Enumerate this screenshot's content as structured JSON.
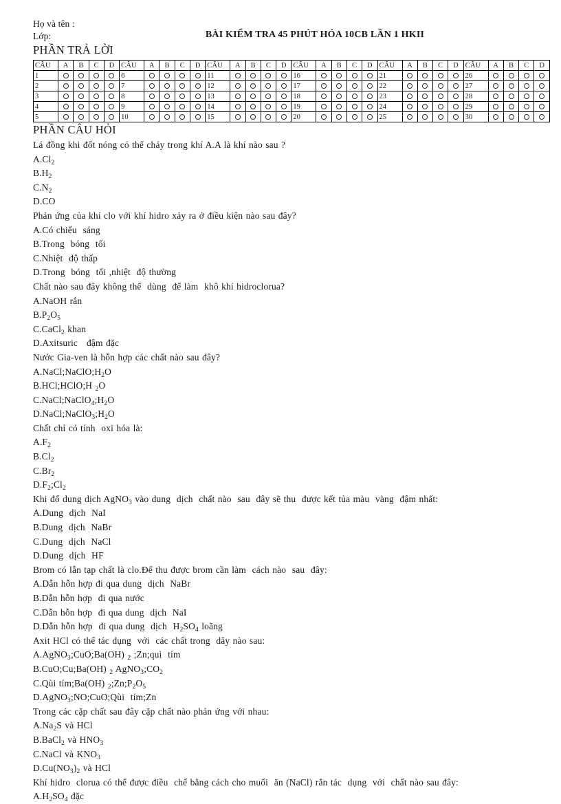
{
  "header": {
    "name_field_label": "Họ và tên :",
    "class_field_label": "Lớp:",
    "title": "BÀI KIỂM TRA 45 PHÚT  HÓA 10CB LẦN 1 HKII",
    "answers_section_heading": "PHẦN TRẢ LỜI",
    "questions_section_heading": "PHẦN CÂU HỎI"
  },
  "answer_table": {
    "column_headers": [
      "CÂU",
      "A",
      "B",
      "C",
      "D"
    ],
    "bubble_glyph": "O",
    "groups": [
      {
        "numbers": [
          "1",
          "2",
          "3",
          "4",
          "5"
        ]
      },
      {
        "numbers": [
          "6",
          "7",
          "8",
          "9",
          "10"
        ]
      },
      {
        "numbers": [
          "11",
          "12",
          "13",
          "14",
          "15"
        ]
      },
      {
        "numbers": [
          "16",
          "17",
          "18",
          "19",
          "20"
        ]
      },
      {
        "numbers": [
          "21",
          "22",
          "23",
          "24",
          "25"
        ]
      },
      {
        "numbers": [
          "26",
          "27",
          "28",
          "29",
          "30"
        ]
      }
    ],
    "rows": 5,
    "groups_count": 6
  },
  "questions": [
    {
      "stem": "Lá đồng khi đốt nóng có thể cháy trong khí A.A là khí nào sau ?",
      "options": [
        "A.Cl<sub>2</sub>",
        "B.H<sub>2</sub>",
        "C.N<sub>2</sub>",
        "D.CO"
      ]
    },
    {
      "stem": "Phản ứng của khí clo với khí hidro xảy ra ở điều kiện nào sau đây?",
      "options": [
        "A.Có chiếu  sáng",
        "B.Trong  bóng  tối",
        "C.Nhiệt  độ thấp",
        "D.Trong  bóng  tối ,nhiệt  độ thường"
      ]
    },
    {
      "stem": "Chất nào sau đây không thể  dùng  để làm  khô khí hidroclorua?",
      "options": [
        "A.NaOH rắn",
        "B.P<sub>2</sub>O<sub>5</sub>",
        "C.CaCl<sub>2</sub> khan",
        "D.Axitsuric   đậm đặc"
      ]
    },
    {
      "stem": "Nước Gia-ven là hỗn hợp các chất nào sau đây?",
      "options": [
        "A.NaCl;NaClO;H<sub>2</sub>O",
        "B.HCl;HClO;H <sub>2</sub>O",
        "C.NaCl;NaClO<sub>4</sub>;H<sub>2</sub>O",
        "D.NaCl;NaClO<sub>3</sub>;H<sub>2</sub>O"
      ]
    },
    {
      "stem": "Chất chỉ có tính  oxi hóa là:",
      "options": [
        "A.F<sub>2</sub>",
        "B.Cl<sub>2</sub>",
        "C.Br<sub>2</sub>",
        "D.F<sub>2</sub>;Cl<sub>2</sub>"
      ]
    },
    {
      "stem": "Khi đổ dung dịch AgNO<sub>3</sub> vào dung  dịch  chất nào  sau  đây sẽ thu  được kết tủa màu  vàng  đậm nhất:",
      "options": [
        "A.Dung  dịch  NaI",
        "B.Dung  dịch  NaBr",
        "C.Dung  dịch  NaCl",
        "D.Dung  dịch  HF"
      ]
    },
    {
      "stem": "Brom có lẫn tạp chất là clo.Để thu được brom cần làm  cách nào  sau  đây:",
      "options": [
        "A.Dẫn hỗn hợp đi qua dung  dịch  NaBr",
        "B.Dẫn hỗn hợp  đi qua nước",
        "C.Dẫn hỗn hợp  đi qua dung  dịch  NaI",
        "D.Dẫn hỗn hợp  đi qua dung  dịch  H<sub>2</sub>SO<sub>4</sub> loãng"
      ]
    },
    {
      "stem": "Axit HCl có thể tác dụng  với  các chất trong  dãy nào sau:",
      "options": [
        "A.AgNO<sub>3</sub>;CuO;Ba(OH) <sub>2</sub> ;Zn;quì  tím",
        "B.CuO;Cu;Ba(OH) <sub>2</sub> AgNO<sub>3</sub>;CO<sub>2</sub>",
        "C.Qùi tím;Ba(OH) <sub>2</sub>;Zn;P<sub>2</sub>O<sub>5</sub>",
        "D.AgNO<sub>3</sub>;NO;CuO;Qùi  tím;Zn"
      ]
    },
    {
      "stem": "Trong các cặp chất sau đây cặp chất nào phản ứng với nhau:",
      "options": [
        "A.Na<sub>2</sub>S và HCl",
        "B.BaCl<sub>2</sub> và HNO<sub>3</sub>",
        "C.NaCl và KNO<sub>3</sub>",
        "D.Cu(NO<sub>3</sub>)<sub>2</sub> và HCl"
      ]
    },
    {
      "stem": "Khí hidro  clorua có thể được điều  chế bằng cách cho muối  ăn (NaCl) rắn tác  dụng  với  chất nào sau đây:",
      "options": [
        "A.H<sub>2</sub>SO<sub>4</sub> đặc"
      ]
    }
  ]
}
